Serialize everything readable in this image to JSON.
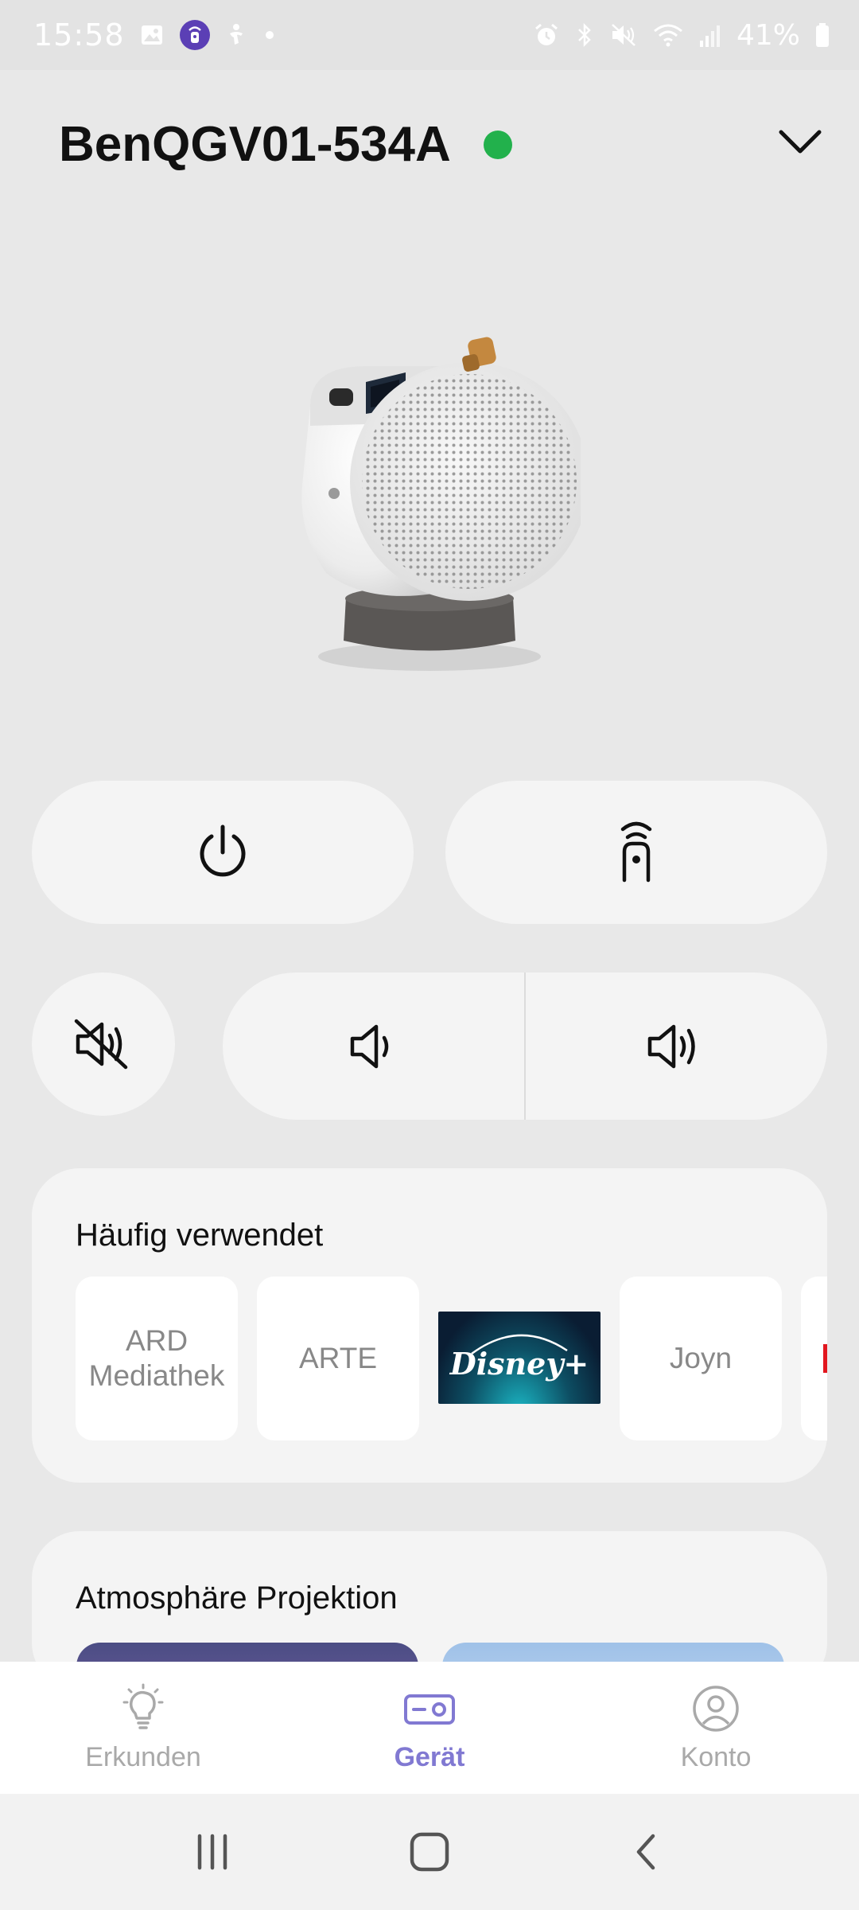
{
  "status_bar": {
    "time": "15:58",
    "battery": "41%",
    "left_icons": [
      "gallery-icon",
      "app-notification-icon",
      "accessibility-icon",
      "dot-icon"
    ],
    "right_icons": [
      "alarm-icon",
      "bluetooth-icon",
      "mute-icon",
      "wifi-icon",
      "signal-icon",
      "battery-icon"
    ]
  },
  "header": {
    "device_name": "BenQGV01-534A",
    "status_color": "#22b14c"
  },
  "controls": {
    "power": "power-icon",
    "remote": "remote-icon",
    "mute": "volume-mute-icon",
    "volume_down": "volume-down-icon",
    "volume_up": "volume-up-icon"
  },
  "favorites": {
    "title": "Häufig verwendet",
    "apps": [
      {
        "label": "ARD\nMediathek"
      },
      {
        "label": "ARTE"
      },
      {
        "label": "Disney+"
      },
      {
        "label": "Joyn"
      }
    ]
  },
  "atmosphere": {
    "title": "Atmosphäre Projektion"
  },
  "bottom_nav": {
    "items": [
      {
        "label": "Erkunden",
        "icon": "lightbulb-icon"
      },
      {
        "label": "Gerät",
        "icon": "projector-icon"
      },
      {
        "label": "Konto",
        "icon": "account-icon"
      }
    ],
    "active_color": "#8179d2"
  },
  "system_nav": {
    "buttons": [
      "recents-icon",
      "home-icon",
      "back-icon"
    ]
  }
}
